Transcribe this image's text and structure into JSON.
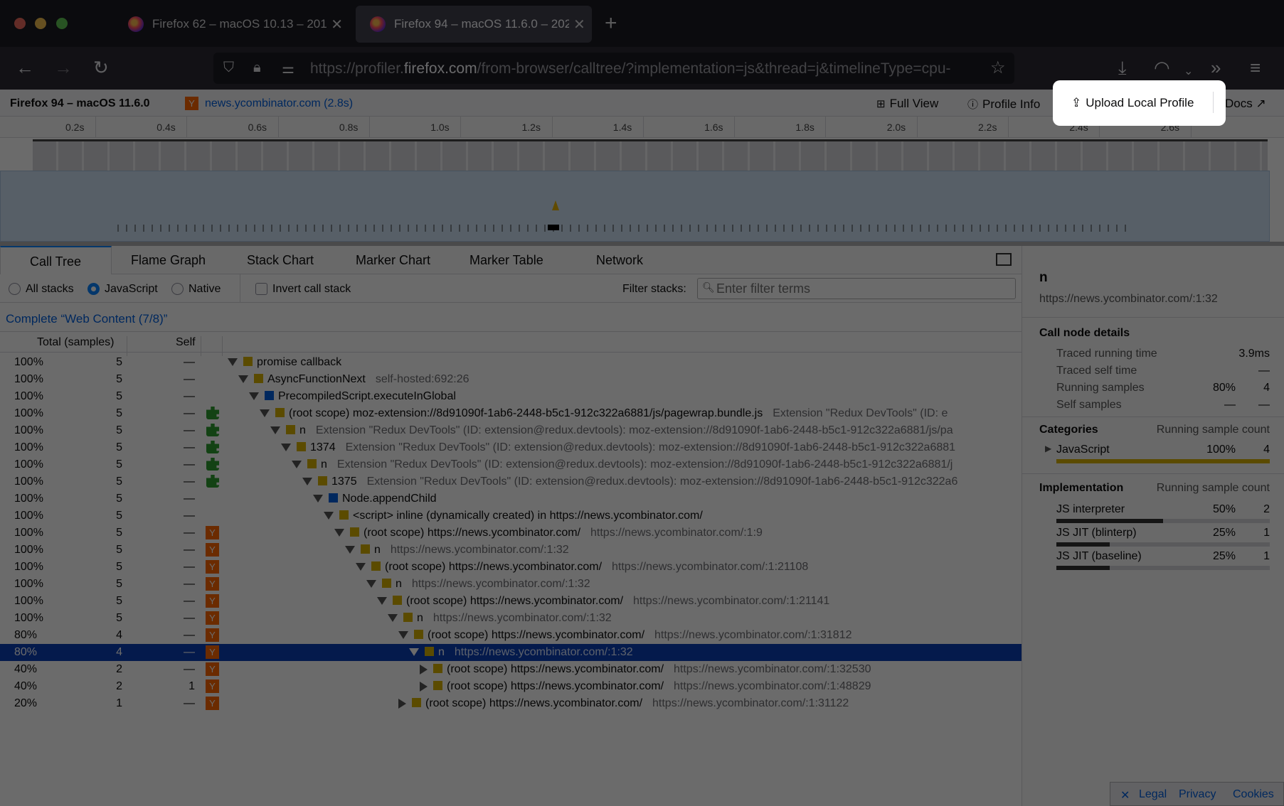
{
  "browser": {
    "tabs": [
      {
        "title": "Firefox 62 – macOS 10.13 – 201"
      },
      {
        "title": "Firefox 94 – macOS 11.6.0 – 202"
      }
    ],
    "url_prefix": "https://profiler.",
    "url_domain": "firefox.com",
    "url_rest": "/from-browser/calltree/?implementation=js&thread=j&timelineType=cpu-"
  },
  "profiler": {
    "profile_name": "Firefox 94 – macOS 11.6.0",
    "tab_link": "news.ycombinator.com (2.8s)",
    "tab_badge": "Y",
    "buttons": {
      "full_view": "Full View",
      "profile_info": "Profile Info",
      "upload": "Upload Local Profile",
      "docs": "Docs"
    },
    "ruler": [
      "0.2s",
      "0.4s",
      "0.6s",
      "0.8s",
      "1.0s",
      "1.2s",
      "1.4s",
      "1.6s",
      "1.8s",
      "2.0s",
      "2.2s",
      "2.4s",
      "2.6s"
    ],
    "panel_tabs": [
      "Call Tree",
      "Flame Graph",
      "Stack Chart",
      "Marker Chart",
      "Marker Table",
      "Network"
    ],
    "settings": {
      "all_stacks": "All stacks",
      "javascript": "JavaScript",
      "native": "Native",
      "invert": "Invert call stack",
      "filter_label": "Filter stacks:",
      "filter_placeholder": "Enter filter terms"
    },
    "breadcrumb": "Complete “Web Content (7/8)”",
    "columns": {
      "total": "Total (samples)",
      "self": "Self"
    },
    "rows": [
      {
        "total": "100%",
        "count": "5",
        "self": "—",
        "cat": "",
        "func": "promise callback",
        "origin": ""
      },
      {
        "total": "100%",
        "count": "5",
        "self": "—",
        "cat": "",
        "func": "AsyncFunctionNext",
        "origin": "self-hosted:692:26"
      },
      {
        "total": "100%",
        "count": "5",
        "self": "—",
        "cat": "",
        "func": "PrecompiledScript.executeInGlobal",
        "origin": ""
      },
      {
        "total": "100%",
        "count": "5",
        "self": "—",
        "cat": "ext",
        "func": "(root scope) moz-extension://8d91090f-1ab6-2448-b5c1-912c322a6881/js/pagewrap.bundle.js",
        "origin": "Extension \"Redux DevTools\" (ID: e"
      },
      {
        "total": "100%",
        "count": "5",
        "self": "—",
        "cat": "ext",
        "func": "n",
        "origin": "Extension \"Redux DevTools\" (ID: extension@redux.devtools): moz-extension://8d91090f-1ab6-2448-b5c1-912c322a6881/js/pa"
      },
      {
        "total": "100%",
        "count": "5",
        "self": "—",
        "cat": "ext",
        "func": "1374",
        "origin": "Extension \"Redux DevTools\" (ID: extension@redux.devtools): moz-extension://8d91090f-1ab6-2448-b5c1-912c322a6881"
      },
      {
        "total": "100%",
        "count": "5",
        "self": "—",
        "cat": "ext",
        "func": "n",
        "origin": "Extension \"Redux DevTools\" (ID: extension@redux.devtools): moz-extension://8d91090f-1ab6-2448-b5c1-912c322a6881/j"
      },
      {
        "total": "100%",
        "count": "5",
        "self": "—",
        "cat": "ext",
        "func": "1375",
        "origin": "Extension \"Redux DevTools\" (ID: extension@redux.devtools): moz-extension://8d91090f-1ab6-2448-b5c1-912c322a6"
      },
      {
        "total": "100%",
        "count": "5",
        "self": "—",
        "cat": "",
        "func": "Node.appendChild",
        "origin": ""
      },
      {
        "total": "100%",
        "count": "5",
        "self": "—",
        "cat": "",
        "func": "<script> inline (dynamically created) in https://news.ycombinator.com/",
        "origin": ""
      },
      {
        "total": "100%",
        "count": "5",
        "self": "—",
        "cat": "Y",
        "func": "(root scope) https://news.ycombinator.com/",
        "origin": "https://news.ycombinator.com/:1:9"
      },
      {
        "total": "100%",
        "count": "5",
        "self": "—",
        "cat": "Y",
        "func": "n",
        "origin": "https://news.ycombinator.com/:1:32"
      },
      {
        "total": "100%",
        "count": "5",
        "self": "—",
        "cat": "Y",
        "func": "(root scope) https://news.ycombinator.com/",
        "origin": "https://news.ycombinator.com/:1:21108"
      },
      {
        "total": "100%",
        "count": "5",
        "self": "—",
        "cat": "Y",
        "func": "n",
        "origin": "https://news.ycombinator.com/:1:32"
      },
      {
        "total": "100%",
        "count": "5",
        "self": "—",
        "cat": "Y",
        "func": "(root scope) https://news.ycombinator.com/",
        "origin": "https://news.ycombinator.com/:1:21141"
      },
      {
        "total": "100%",
        "count": "5",
        "self": "—",
        "cat": "Y",
        "func": "n",
        "origin": "https://news.ycombinator.com/:1:32"
      },
      {
        "total": "80%",
        "count": "4",
        "self": "—",
        "cat": "Y",
        "func": "(root scope) https://news.ycombinator.com/",
        "origin": "https://news.ycombinator.com/:1:31812"
      },
      {
        "total": "80%",
        "count": "4",
        "self": "—",
        "cat": "Y",
        "func": "n",
        "origin": "https://news.ycombinator.com/:1:32"
      },
      {
        "total": "40%",
        "count": "2",
        "self": "—",
        "cat": "Y",
        "func": "(root scope) https://news.ycombinator.com/",
        "origin": "https://news.ycombinator.com/:1:32530"
      },
      {
        "total": "40%",
        "count": "2",
        "self": "1",
        "cat": "Y",
        "func": "(root scope) https://news.ycombinator.com/",
        "origin": "https://news.ycombinator.com/:1:48829"
      },
      {
        "total": "20%",
        "count": "1",
        "self": "—",
        "cat": "Y",
        "func": "(root scope) https://news.ycombinator.com/",
        "origin": "https://news.ycombinator.com/:1:31122"
      }
    ],
    "sidebar": {
      "node_name": "n",
      "node_location": "https://news.ycombinator.com/:1:32",
      "details_heading": "Call node details",
      "traced_running_label": "Traced running time",
      "traced_running_value": "3.9ms",
      "traced_self_label": "Traced self time",
      "traced_self_value": "—",
      "running_samples_label": "Running samples",
      "running_samples_pct": "80%",
      "running_samples_count": "4",
      "self_samples_label": "Self samples",
      "self_samples_pct": "—",
      "self_samples_count": "—",
      "categories_heading": "Categories",
      "count_heading": "Running sample count",
      "cat_js_label": "JavaScript",
      "cat_js_pct": "100%",
      "cat_js_count": "4",
      "impl_heading": "Implementation",
      "impl_rows": [
        {
          "label": "JS interpreter",
          "pct": "50%",
          "count": "2",
          "fraction": 0.5
        },
        {
          "label": "JS JIT (blinterp)",
          "pct": "25%",
          "count": "1",
          "fraction": 0.25
        },
        {
          "label": "JS JIT (baseline)",
          "pct": "25%",
          "count": "1",
          "fraction": 0.25
        }
      ]
    },
    "footer": {
      "close": "✕",
      "legal": "Legal",
      "privacy": "Privacy",
      "cookies": "Cookies"
    }
  },
  "colors": {
    "accent": "#0a84ff",
    "selection": "#0a3fb6",
    "js_category": "#d8b400",
    "dom_category": "#0060df",
    "hn_orange": "#ff6600"
  }
}
